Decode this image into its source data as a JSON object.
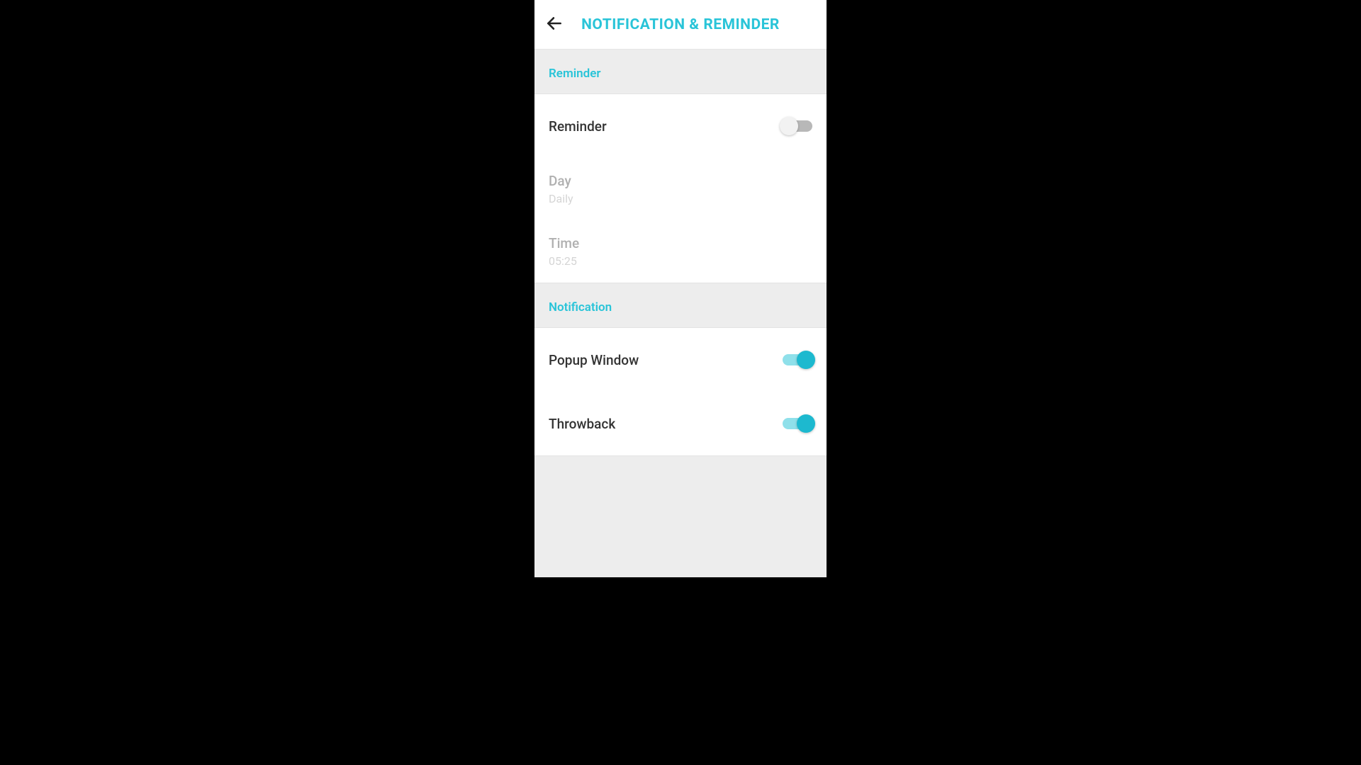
{
  "header": {
    "title": "NOTIFICATION & REMINDER"
  },
  "colors": {
    "accent": "#29c4d8"
  },
  "sections": {
    "reminder": {
      "header": "Reminder",
      "toggle": {
        "label": "Reminder",
        "on": false
      },
      "day": {
        "label": "Day",
        "value": "Daily",
        "enabled": false
      },
      "time": {
        "label": "Time",
        "value": "05:25",
        "enabled": false
      }
    },
    "notification": {
      "header": "Notification",
      "popup": {
        "label": "Popup Window",
        "on": true
      },
      "throwback": {
        "label": "Throwback",
        "on": true
      }
    }
  }
}
